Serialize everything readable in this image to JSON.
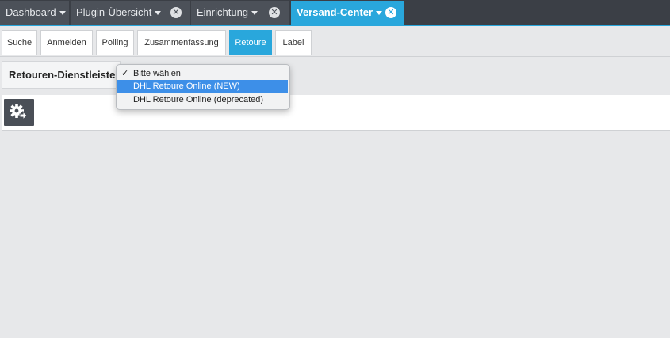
{
  "top_tabs": [
    {
      "label": "Dashboard",
      "closable": false,
      "active": false
    },
    {
      "label": "Plugin-Übersicht",
      "closable": true,
      "active": false
    },
    {
      "label": "Einrichtung",
      "closable": true,
      "active": false
    },
    {
      "label": "Versand-Center",
      "closable": true,
      "active": true
    }
  ],
  "sub_tabs": [
    "Suche",
    "Anmelden",
    "Polling",
    "Zusammenfassung",
    "Retoure",
    "Label"
  ],
  "active_sub_tab": "Retoure",
  "retouren": {
    "label": "Retouren-Dienstleister",
    "dropdown": {
      "options": [
        "Bitte wählen",
        "DHL Retoure Online (NEW)",
        "DHL Retoure Online (deprecated)"
      ],
      "checked": "Bitte wählen",
      "highlighted": "DHL Retoure Online (NEW)"
    }
  },
  "icons": {
    "close": "close-icon",
    "gear": "gear-arrow-icon"
  },
  "colors": {
    "accent": "#29a7dc",
    "menu_highlight": "#3d8fe8"
  }
}
